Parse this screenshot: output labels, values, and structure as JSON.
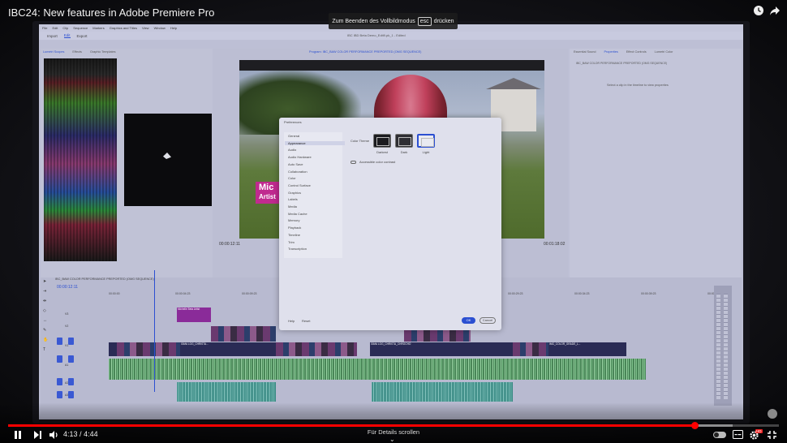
{
  "video": {
    "title": "IBC24: New features in Adobe Premiere Pro",
    "fullscreen_hint": {
      "before": "Zum Beenden des Vollbildmodus",
      "key": "esc",
      "after": "drücken"
    },
    "current_time": "4:13",
    "duration": "4:44",
    "time_separator": "/",
    "scroll_hint": "Für Details scrollen",
    "progress_fraction": 0.89,
    "buffered_fraction": 0.94,
    "accent_color": "#ff0000"
  },
  "controls": {
    "play_pause_icon": "pause-icon",
    "next_icon": "next-icon",
    "volume_icon": "volume-icon",
    "settings_icon": "gear-icon",
    "fullscreen_exit_icon": "exit-fullscreen-icon",
    "clock_icon": "clock-icon",
    "share_icon": "share-icon"
  },
  "app": {
    "menu": [
      "File",
      "Edit",
      "Clip",
      "Sequence",
      "Markers",
      "Graphics and Titles",
      "View",
      "Window",
      "Help"
    ],
    "workspaces": [
      "Import",
      "Edit",
      "Export"
    ],
    "active_workspace": "Edit",
    "window_title": "IBC IBD Beta Demo_Edit9.pk_1 - Edited",
    "scopes_tabs": [
      "Lumetri Scopes",
      "Effects",
      "Graphic Templates"
    ],
    "active_scopes_tab": "Lumetri Scopes",
    "program_tab": "Program: IBC_BAW COLOR PERFORMANCE PREPORTED (OMG SEQUENCE)",
    "properties_tabs": [
      "Essential Sound",
      "Properties",
      "Effect Controls",
      "Lumetri Color"
    ],
    "active_properties_tab": "Properties",
    "properties_hint": "Select a clip in the timeline to view properties",
    "properties_crumb": "IBC_BAW COLOR PERFORMANCE PREPORTED (OMG SEQUENCE)",
    "program_timecode_left": "00:00:12:11",
    "program_timecode_right": "00:01:18:02",
    "lower_third": {
      "line1": "Mic",
      "line2": "Artist"
    },
    "timeline": {
      "tab": "IBC_BAW COLOR PERFORMANCE PREPORTED (OMG SEQUENCE)",
      "timecode": "00:00:12:11",
      "ruler": [
        "00:00:00",
        "00:00:04:23",
        "00:00:09:23",
        "00:00:14:23",
        "00:00:19:23",
        "00:00:24:23",
        "00:00:29:23",
        "00:00:34:23",
        "00:00:39:23",
        "00:00:44:23"
      ],
      "tracks": [
        "V3",
        "V2",
        "V1",
        "A1",
        "A2",
        "A3"
      ],
      "clips": [
        {
          "name": "Michelle Beta Artist",
          "track": "V3"
        },
        {
          "name": "GIMA LOG_CHRISTA...",
          "track": "V1"
        },
        {
          "name": "GIMA LOG_CHRISTA_CHROCHO",
          "track": "V1"
        },
        {
          "name": "IMG_COLOR_GRADE_L...",
          "track": "V1"
        }
      ]
    }
  },
  "preferences": {
    "title": "Preferences",
    "categories": [
      "General",
      "Appearance",
      "Audio",
      "Audio Hardware",
      "Auto Save",
      "Collaboration",
      "Color",
      "Control Surface",
      "Graphics",
      "Labels",
      "Media",
      "Media Cache",
      "Memory",
      "Playback",
      "Timeline",
      "Trim",
      "Transcription"
    ],
    "selected_category": "Appearance",
    "color_theme_label": "Color Theme",
    "themes": [
      {
        "name": "Darkest",
        "color": "#1b1b1f"
      },
      {
        "name": "Dark",
        "color": "#2e2e33"
      },
      {
        "name": "Light",
        "color": "#e9eaf1"
      }
    ],
    "selected_theme": "Light",
    "accessible_color_label": "Accessible color contrast",
    "help_label": "Help",
    "reset_label": "Reset",
    "ok_label": "OK",
    "cancel_label": "Cancel"
  }
}
